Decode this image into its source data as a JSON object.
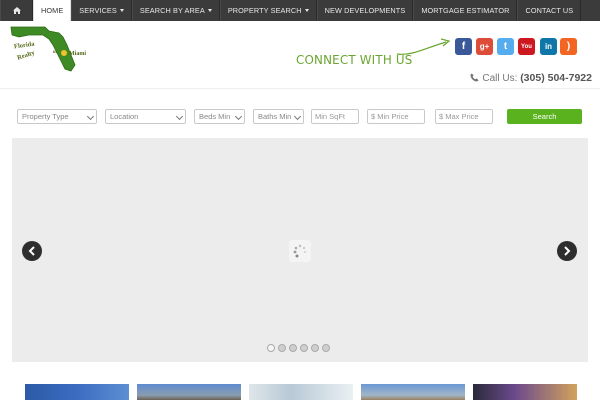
{
  "nav": {
    "items": [
      {
        "label": "HOME",
        "dropdown": false
      },
      {
        "label": "SERVICES",
        "dropdown": true
      },
      {
        "label": "SEARCH BY AREA",
        "dropdown": true
      },
      {
        "label": "PROPERTY SEARCH",
        "dropdown": true
      },
      {
        "label": "NEW DEVELOPMENTS",
        "dropdown": false
      },
      {
        "label": "MORTGAGE ESTIMATOR",
        "dropdown": false
      },
      {
        "label": "CONTACT US",
        "dropdown": false
      }
    ],
    "home_icon": "home-icon",
    "active_index": 0
  },
  "header": {
    "logo": {
      "line1": "Florida",
      "line2": "Realty",
      "line3": "of",
      "line4": "Miami"
    },
    "connect_text": "CONNECT WITH US",
    "social": [
      {
        "icon": "facebook-icon",
        "color": "#3b5998",
        "glyph": "f"
      },
      {
        "icon": "google-plus-icon",
        "color": "#dd4b39",
        "glyph": "g+"
      },
      {
        "icon": "twitter-icon",
        "color": "#55acee",
        "glyph": "t"
      },
      {
        "icon": "youtube-icon",
        "color": "#cc181e",
        "glyph": "You"
      },
      {
        "icon": "linkedin-icon",
        "color": "#0e76a8",
        "glyph": "in"
      },
      {
        "icon": "rss-icon",
        "color": "#f26522",
        "glyph": ")"
      }
    ],
    "call_label": "Call Us:",
    "phone": "(305) 504-7922"
  },
  "search": {
    "property_type": "Property Type",
    "location": "Location",
    "beds_min": "Beds Min",
    "baths_min": "Baths Min",
    "min_sqft": "Min SqFt",
    "min_price": "$ Min Price",
    "max_price": "$ Max Price",
    "button": "Search"
  },
  "slider": {
    "slide_count": 6,
    "active_slide": 0
  },
  "colors": {
    "nav_bg": "#3b3b3b",
    "accent_green": "#5ab21e",
    "connect_green": "#6aa530"
  }
}
